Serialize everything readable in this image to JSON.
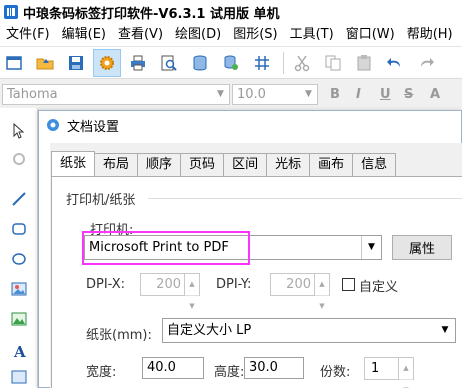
{
  "window": {
    "title": "中琅条码标签打印软件-V6.3.1 试用版 单机"
  },
  "menu": {
    "items": [
      "文件(F)",
      "编辑(E)",
      "查看(V)",
      "绘图(D)",
      "图形(S)",
      "工具(T)",
      "窗口(W)",
      "帮助(H)"
    ]
  },
  "fontbar": {
    "font_name": "Tahoma",
    "font_size": "10.0",
    "buttons": [
      "B",
      "I",
      "U",
      "S",
      "A"
    ]
  },
  "dialog": {
    "title": "文档设置",
    "tabs": [
      "纸张",
      "布局",
      "顺序",
      "页码",
      "区间",
      "光标",
      "画布",
      "信息"
    ],
    "active_tab": "纸张",
    "group_label": "打印机/纸张",
    "printer_label": "打印机:",
    "printer_value": "Microsoft Print to PDF",
    "properties_button": "属性",
    "dpi_x_label": "DPI-X:",
    "dpi_x_value": "200",
    "dpi_y_label": "DPI-Y:",
    "dpi_y_value": "200",
    "custom_label": "自定义",
    "paper_label": "纸张(mm):",
    "paper_value": "自定义大小 LP",
    "width_label": "宽度:",
    "width_value": "40.0",
    "height_label": "高度:",
    "height_value": "30.0",
    "copies_label": "份数:",
    "copies_value": "1"
  },
  "colors": {
    "highlight_border": "#ff33ff",
    "active_toolbar_bg": "#cce4f7",
    "dialog_border": "#9fb3cf"
  }
}
